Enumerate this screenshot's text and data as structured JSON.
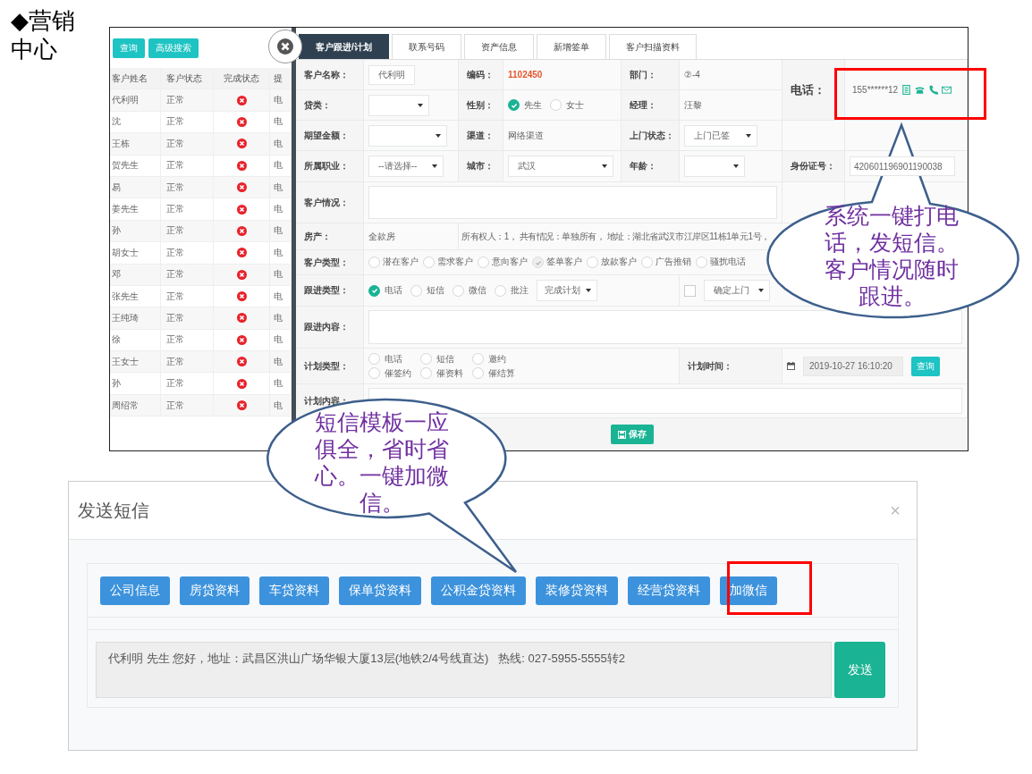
{
  "slide_title": "◆营销中心",
  "list": {
    "buttons": [
      "查询",
      "高级搜索"
    ],
    "columns": [
      "客户姓名",
      "客户状态",
      "完成状态",
      "提"
    ],
    "rows": [
      {
        "name": "代利明",
        "status": "正常",
        "completed": false,
        "remind": "电"
      },
      {
        "name": "沈",
        "status": "正常",
        "completed": false,
        "remind": "电"
      },
      {
        "name": "王栋",
        "status": "正常",
        "completed": false,
        "remind": "电"
      },
      {
        "name": "贺先生",
        "status": "正常",
        "completed": false,
        "remind": "电"
      },
      {
        "name": "易",
        "status": "正常",
        "completed": false,
        "remind": "电"
      },
      {
        "name": "姜先生",
        "status": "正常",
        "completed": false,
        "remind": "电"
      },
      {
        "name": "孙",
        "status": "正常",
        "completed": false,
        "remind": "电"
      },
      {
        "name": "胡女士",
        "status": "正常",
        "completed": false,
        "remind": "电"
      },
      {
        "name": "邓",
        "status": "正常",
        "completed": false,
        "remind": "电"
      },
      {
        "name": "张先生",
        "status": "正常",
        "completed": false,
        "remind": "电"
      },
      {
        "name": "王纯琦",
        "status": "正常",
        "completed": false,
        "remind": "电"
      },
      {
        "name": "徐",
        "status": "正常",
        "completed": false,
        "remind": "电"
      },
      {
        "name": "王女士",
        "status": "正常",
        "completed": false,
        "remind": "电"
      },
      {
        "name": "孙",
        "status": "正常",
        "completed": false,
        "remind": "电"
      },
      {
        "name": "周绍常",
        "status": "正常",
        "completed": false,
        "remind": "电"
      }
    ]
  },
  "form": {
    "tabs": [
      {
        "label": "客户跟进/计划",
        "selected": true
      },
      {
        "label": "联系号码",
        "selected": false
      },
      {
        "label": "资产信息",
        "selected": false
      },
      {
        "label": "新增签单",
        "selected": false
      },
      {
        "label": "客户扫描资料",
        "selected": false
      }
    ],
    "customer_name": {
      "label": "客户名称：",
      "value": "代利明"
    },
    "code": {
      "label": "编码：",
      "value": "1102450"
    },
    "department": {
      "label": "部门：",
      "value": "②-4"
    },
    "phone": {
      "label": "电话：",
      "value": "155******12"
    },
    "loan_type": {
      "label": "贷类："
    },
    "gender": {
      "label": "性别：",
      "options": [
        {
          "label": "先生",
          "selected": true
        },
        {
          "label": "女士",
          "selected": false
        }
      ]
    },
    "manager": {
      "label": "经理：",
      "value": "汪黎"
    },
    "expected_amount": {
      "label": "期望金额："
    },
    "channel": {
      "label": "渠道：",
      "value": "网络渠道"
    },
    "visit_status": {
      "label": "上门状态：",
      "value": "上门已签"
    },
    "occupation": {
      "label": "所属职业：",
      "value": "--请选择--"
    },
    "city": {
      "label": "城市：",
      "value": "武汉"
    },
    "age": {
      "label": "年龄："
    },
    "id_number": {
      "label": "身份证号：",
      "value": "420601196901190038"
    },
    "situation": {
      "label": "客户情况："
    },
    "property": {
      "label": "房产：",
      "value": "全款房",
      "details": "所有权人：1， 共有情况：单独所有， 地址：湖北省武汉市江岸区11栋1单元1号，"
    },
    "customer_type": {
      "label": "客户类型：",
      "disabled": true,
      "options": [
        {
          "label": "潜在客户",
          "selected": false
        },
        {
          "label": "需求客户",
          "selected": false
        },
        {
          "label": "意向客户",
          "selected": false
        },
        {
          "label": "签单客户",
          "selected": true
        },
        {
          "label": "放款客户",
          "selected": false
        },
        {
          "label": "广告推销",
          "selected": false
        },
        {
          "label": "骚扰电话",
          "selected": false
        }
      ]
    },
    "follow_type": {
      "label": "跟进类型：",
      "options": [
        {
          "label": "电话",
          "selected": true
        },
        {
          "label": "短信",
          "selected": false
        },
        {
          "label": "微信",
          "selected": false
        },
        {
          "label": "批注",
          "selected": false
        }
      ],
      "result": "完成计划",
      "visit_checked": false,
      "visit_select": "确定上门"
    },
    "follow_content": {
      "label": "跟进内容："
    },
    "plan_type": {
      "label": "计划类型：",
      "options": [
        {
          "label": "电话",
          "selected": false
        },
        {
          "label": "短信",
          "selected": false
        },
        {
          "label": "邀约",
          "selected": false
        },
        {
          "label": "催签约",
          "selected": false
        },
        {
          "label": "催资料",
          "selected": false
        },
        {
          "label": "催结算",
          "selected": false
        }
      ]
    },
    "plan_time": {
      "label": "计划时间：",
      "value": "2019-10-27 16:10:20",
      "button": "查询"
    },
    "plan_content": {
      "label": "计划内容："
    },
    "save_button": "保存"
  },
  "sms_dialog": {
    "title": "发送短信",
    "close": "×",
    "templates": [
      "公司信息",
      "房贷资料",
      "车贷资料",
      "保单贷资料",
      "公积金贷资料",
      "装修贷资料",
      "经营贷资料",
      "加微信"
    ],
    "message": "代利明 先生 您好，地址：武昌区洪山广场华银大厦13层(地铁2/4号线直达)   热线: 027-5955-5555转2",
    "send_button": "发送"
  },
  "callouts": [
    {
      "text": "系统一键打电话，发短信。客户情况随时跟进。"
    },
    {
      "text": "短信模板一应俱全，省时省心。一键加微信。"
    }
  ]
}
